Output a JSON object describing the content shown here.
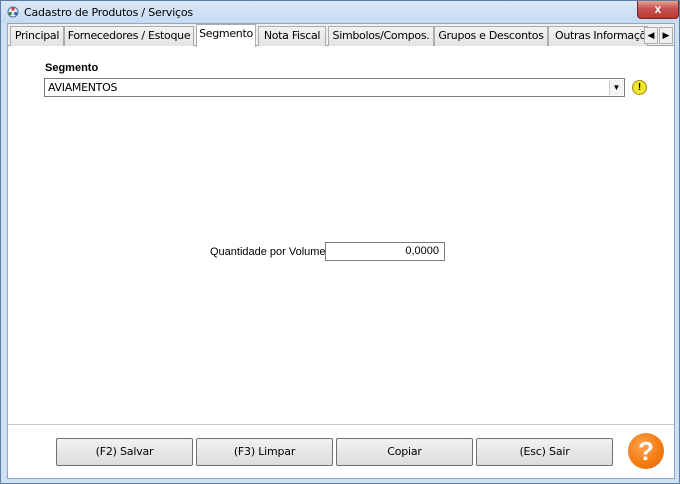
{
  "window": {
    "title": "Cadastro de Produtos / Serviços",
    "close_glyph": "x"
  },
  "tabs": [
    {
      "label": "Principal"
    },
    {
      "label": "Fornecedores / Estoque"
    },
    {
      "label": "Segmento"
    },
    {
      "label": "Nota Fiscal"
    },
    {
      "label": "Simbolos/Compos."
    },
    {
      "label": "Grupos e Descontos"
    },
    {
      "label": "Outras Informações"
    }
  ],
  "active_tab": "Segmento",
  "tab_scroll": {
    "left_glyph": "◀",
    "right_glyph": "▶"
  },
  "segmento": {
    "label": "Segmento",
    "value": "AVIAMENTOS",
    "warning_glyph": "!"
  },
  "quantidade": {
    "label": "Quantidade por Volume:",
    "value": "0,0000"
  },
  "buttons": {
    "save": "(F2) Salvar",
    "clear": "(F3) Limpar",
    "copy": "Copiar",
    "exit": "(Esc) Sair",
    "help_glyph": "?"
  },
  "colors": {
    "window_frame": "#cfe0f2",
    "close_button": "#c75050",
    "help_button": "#f27a10",
    "warning_icon": "#f5e52a"
  },
  "icons": [
    "app-icon",
    "close-icon",
    "tab-scroll-left-icon",
    "tab-scroll-right-icon",
    "dropdown-arrow-icon",
    "warning-icon",
    "help-icon"
  ]
}
